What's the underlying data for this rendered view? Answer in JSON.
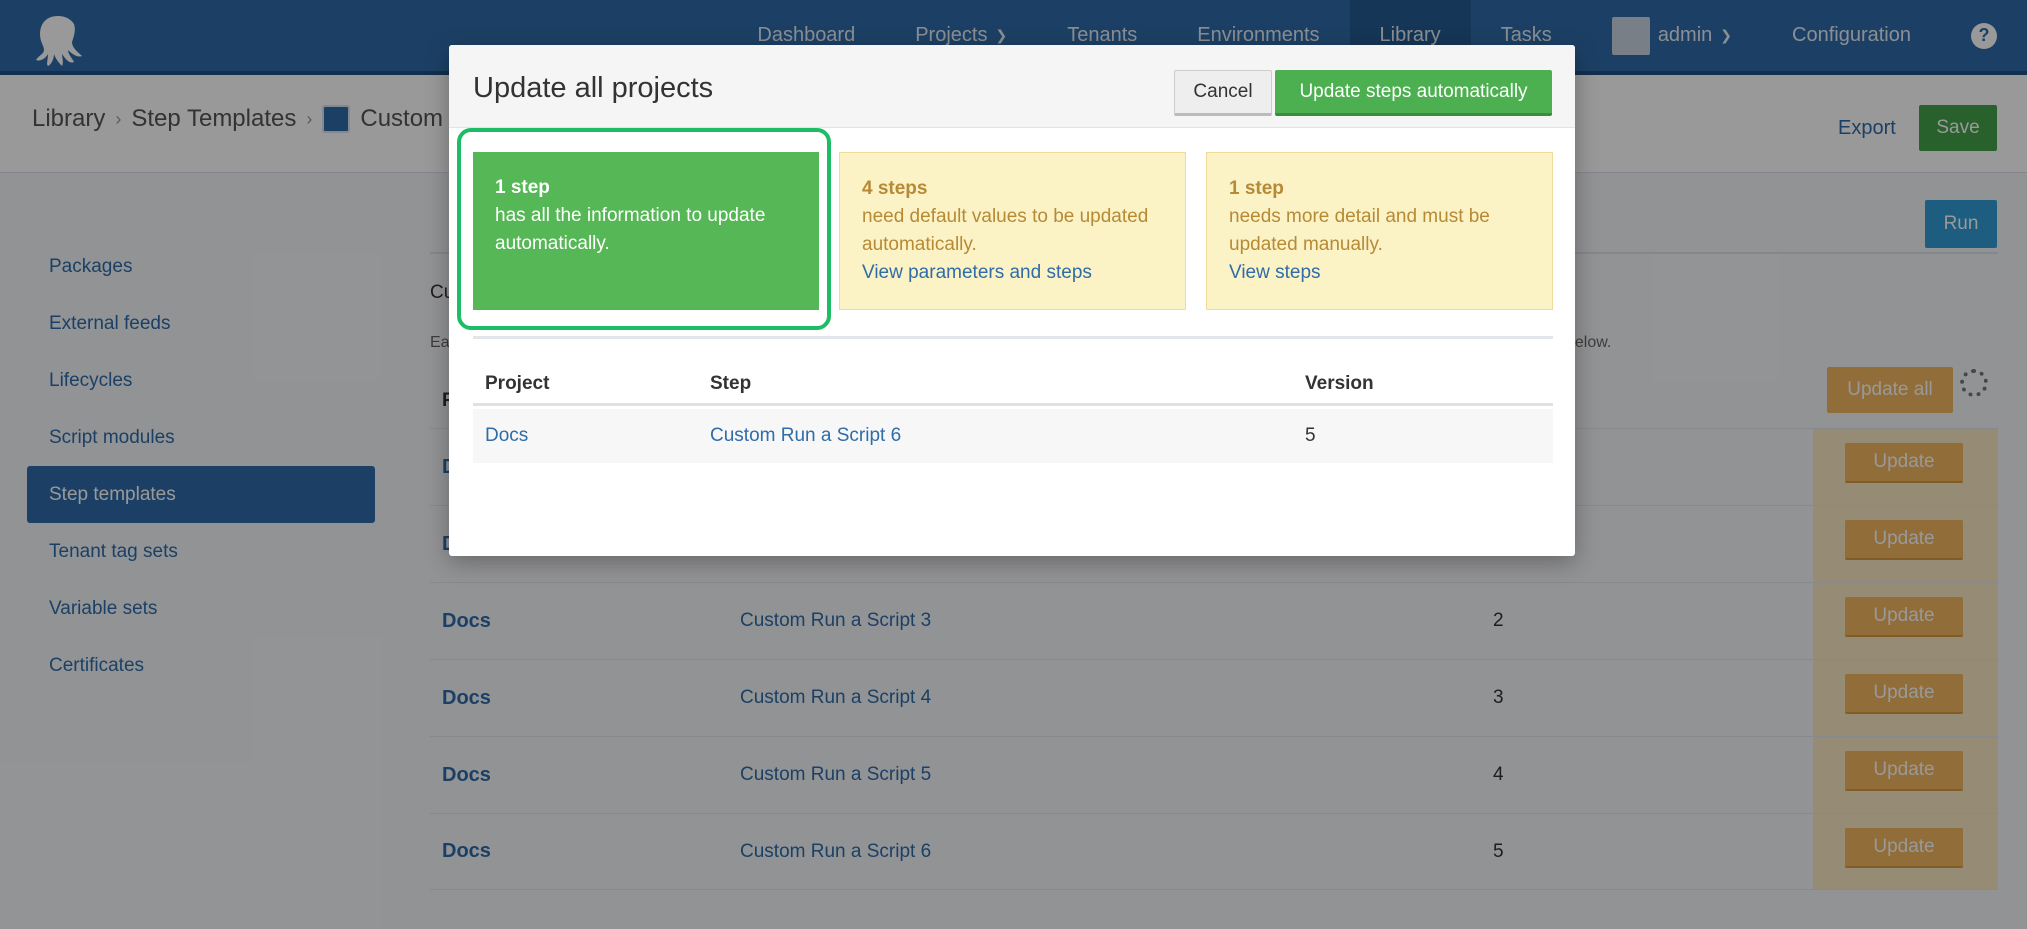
{
  "nav": {
    "items": [
      {
        "label": "Dashboard"
      },
      {
        "label": "Projects",
        "has_chevron": true
      },
      {
        "label": "Tenants"
      },
      {
        "label": "Environments"
      },
      {
        "label": "Library",
        "active": true
      },
      {
        "label": "Tasks"
      }
    ],
    "user": "admin",
    "configuration": "Configuration",
    "help": "?"
  },
  "breadcrumb": {
    "items": [
      "Library",
      "Step Templates",
      "Custom"
    ],
    "export": "Export",
    "save": "Save"
  },
  "sidebar": {
    "items": [
      {
        "label": "Packages"
      },
      {
        "label": "External feeds"
      },
      {
        "label": "Lifecycles"
      },
      {
        "label": "Script modules"
      },
      {
        "label": "Step templates",
        "active": true
      },
      {
        "label": "Tenant tag sets"
      },
      {
        "label": "Variable sets"
      },
      {
        "label": "Certificates"
      }
    ]
  },
  "main": {
    "run": "Run",
    "intro_start": "Cu",
    "intro2_start": "Ea",
    "intro2_end": "below.",
    "update_all": "Update all",
    "header_col_start": "P",
    "rows": [
      {
        "project": "D",
        "step": "",
        "version": ""
      },
      {
        "project": "D",
        "step": "",
        "version": ""
      },
      {
        "project": "Docs",
        "step": "Custom Run a Script 3",
        "version": "2"
      },
      {
        "project": "Docs",
        "step": "Custom Run a Script 4",
        "version": "3"
      },
      {
        "project": "Docs",
        "step": "Custom Run a Script 5",
        "version": "4"
      },
      {
        "project": "Docs",
        "step": "Custom Run a Script 6",
        "version": "5"
      }
    ],
    "row_update_label": "Update"
  },
  "modal": {
    "title": "Update all projects",
    "cancel": "Cancel",
    "update_auto": "Update steps automatically",
    "cards": [
      {
        "count": "1 step",
        "desc": "has all the information to update automatically.",
        "link": ""
      },
      {
        "count": "4 steps",
        "desc": "need default values to be updated automatically.",
        "link": "View parameters and steps"
      },
      {
        "count": "1 step",
        "desc": "needs more detail and must be updated manually.",
        "link": "View steps"
      }
    ],
    "table": {
      "headers": [
        "Project",
        "Step",
        "Version"
      ],
      "rows": [
        {
          "project": "Docs",
          "step": "Custom Run a Script 6",
          "version": "5"
        }
      ]
    }
  },
  "colors": {
    "nav": "#2f6ca8",
    "accent_green": "#4cb050",
    "warning_yellow": "#fbf2c5",
    "update_orange": "#f0b660",
    "highlight": "#1cbd64"
  }
}
